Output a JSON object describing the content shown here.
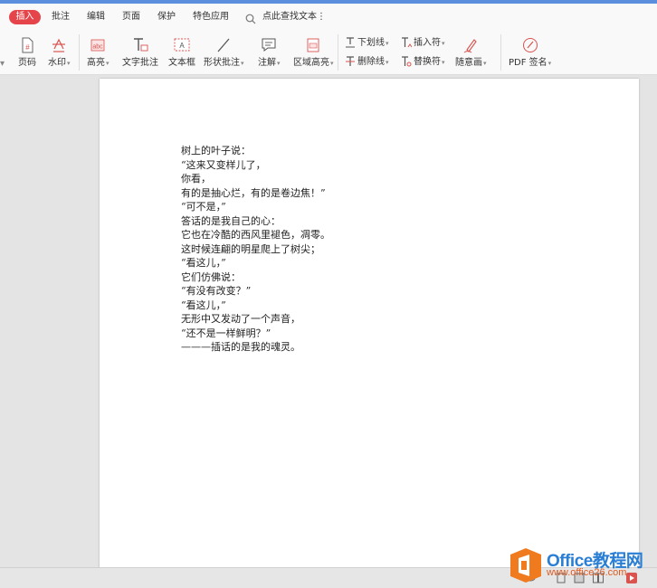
{
  "menubar": {
    "active_tab": "插入",
    "tabs": [
      "批注",
      "编辑",
      "页面",
      "保护",
      "特色应用"
    ],
    "search_placeholder": "点此查找文本",
    "more": "⋮"
  },
  "ribbon": {
    "page_number": "页码",
    "watermark": "水印",
    "highlight": "高亮",
    "text_comment": "文字批注",
    "text_box": "文本框",
    "shape_comment": "形状批注",
    "annotation": "注解",
    "area_highlight": "区域高亮",
    "underline": "下划线",
    "strikethrough": "删除线",
    "insert_char": "插入符",
    "replace_char": "替换符",
    "freehand": "随意画",
    "pdf_sign": "PDF 签名",
    "caret": "▾"
  },
  "document": {
    "lines": [
      "树上的叶子说：",
      "“这来又变样儿了，",
      "你看，",
      "有的是抽心烂，有的是卷边焦！”",
      "“可不是，”",
      "答话的是我自己的心：",
      "它也在冷酷的西风里褪色，凋零。",
      "这时候连翩的明星爬上了树尖；",
      "“看这儿，”",
      "它们仿佛说：",
      "“有没有改变？”",
      "“看这儿，”",
      "无形中又发动了一个声音，",
      "“还不是一样鲜明？”",
      "———插话的是我的魂灵。"
    ]
  },
  "watermark_logo": {
    "title": "Office教程网",
    "url": "www.office26.com"
  },
  "colors": {
    "accent": "#e5454a",
    "top_bar": "#5b8fde",
    "icon_red": "#d9534f",
    "logo_blue": "#2a7fd4",
    "logo_orange": "#e05a20"
  }
}
